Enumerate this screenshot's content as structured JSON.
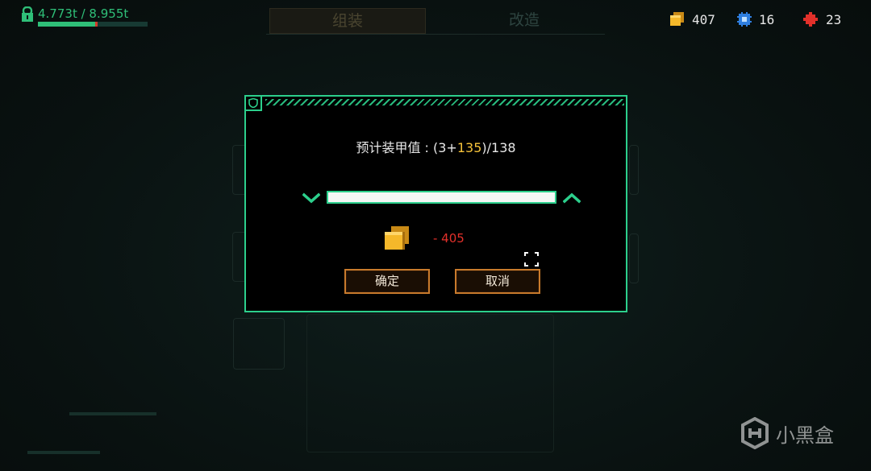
{
  "hud": {
    "weight_current": "4.773t",
    "weight_sep": " / ",
    "weight_max": "8.955t",
    "weight_fraction": 0.533,
    "resources": [
      {
        "icon": "gold-cube-icon",
        "value": "407",
        "color": "#f5b82a"
      },
      {
        "icon": "blue-chip-icon",
        "value": "16",
        "color": "#2f7fe0"
      },
      {
        "icon": "red-puzzle-icon",
        "value": "23",
        "color": "#e2302a"
      }
    ]
  },
  "tabs": {
    "assemble": "组装",
    "modify": "改造"
  },
  "dialog": {
    "title_prefix": "预计装甲值 : (3+",
    "title_highlight": "135",
    "title_suffix": ")/138",
    "slider_fraction": 1.0,
    "cost_icon": "gold-cube-icon",
    "cost_text": "- 405",
    "confirm_label": "确定",
    "cancel_label": "取消"
  },
  "watermark": {
    "text": "小黑盒"
  },
  "colors": {
    "accent": "#2ccf8c",
    "highlight": "#f5c23a",
    "cost": "#e2302a",
    "button_border": "#c87a2c"
  }
}
